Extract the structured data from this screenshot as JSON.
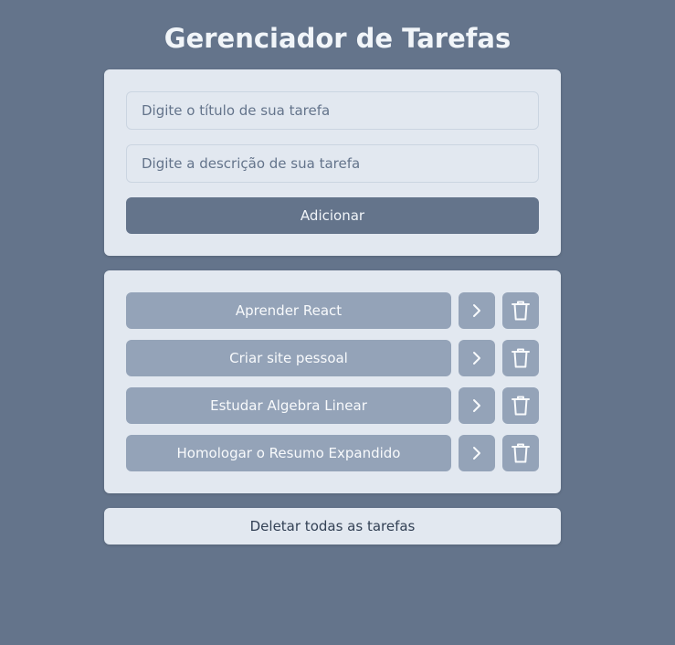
{
  "page": {
    "title": "Gerenciador de Tarefas"
  },
  "form": {
    "title_input": {
      "value": "",
      "placeholder": "Digite o título de sua tarefa"
    },
    "description_input": {
      "value": "",
      "placeholder": "Digite a descrição de sua tarefa"
    },
    "add_label": "Adicionar"
  },
  "tasks": [
    {
      "title": "Aprender React",
      "open_icon": "chevron-right-icon",
      "delete_icon": "trash-icon"
    },
    {
      "title": "Criar site pessoal",
      "open_icon": "chevron-right-icon",
      "delete_icon": "trash-icon"
    },
    {
      "title": "Estudar Algebra Linear",
      "open_icon": "chevron-right-icon",
      "delete_icon": "trash-icon"
    },
    {
      "title": "Homologar o Resumo Expandido",
      "open_icon": "chevron-right-icon",
      "delete_icon": "trash-icon"
    }
  ],
  "delete_all_label": "Deletar todas as tarefas",
  "colors": {
    "background": "#64748b",
    "panel": "#e2e8f0",
    "task_button": "#94a3b8",
    "primary_button": "#64748b",
    "title_text": "#f1f5f9"
  }
}
